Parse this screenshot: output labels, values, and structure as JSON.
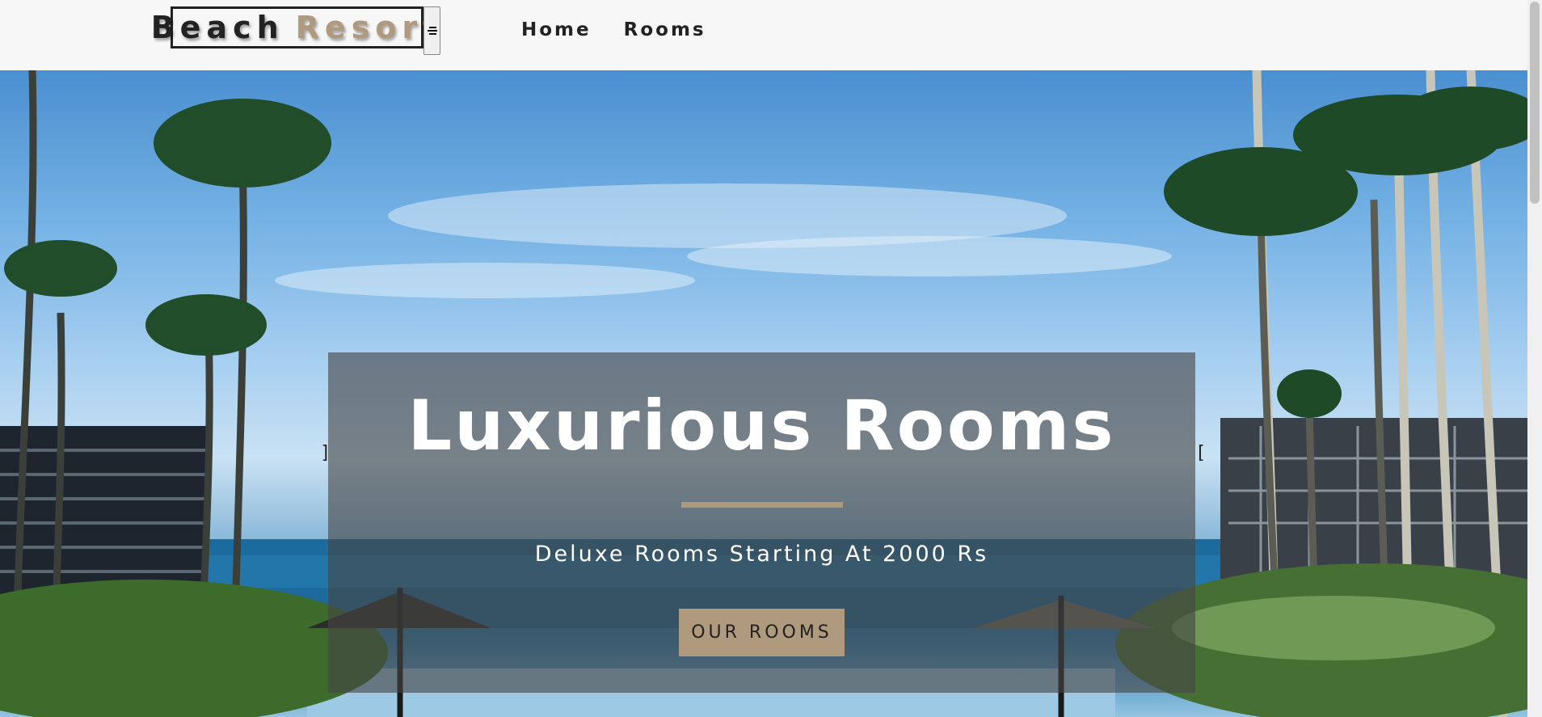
{
  "navbar": {
    "logo_word1": "Beach",
    "logo_word2": "Resort",
    "toggle_icon": "menu-icon",
    "links": [
      "Home",
      "Rooms"
    ]
  },
  "hero": {
    "title": "Luxurious Rooms",
    "subtitle": "Deluxe Rooms Starting At 2000 Rs",
    "button_label": "OUR ROOMS",
    "left_bracket": "]",
    "right_bracket": "["
  },
  "colors": {
    "accent": "#af9a7d",
    "dark": "#222222",
    "navbar_bg": "#f7f7f7"
  }
}
